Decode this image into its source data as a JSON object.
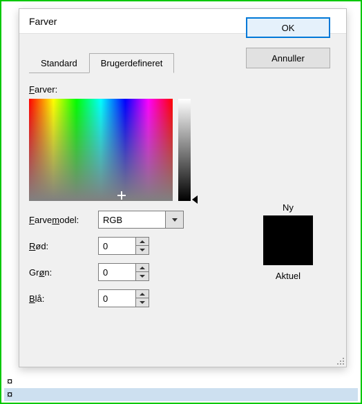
{
  "dialog": {
    "title": "Farver",
    "help": "?",
    "close": "✕"
  },
  "tabs": {
    "standard": "Standard",
    "custom": "Brugerdefineret"
  },
  "buttons": {
    "ok": "OK",
    "cancel": "Annuller"
  },
  "labels": {
    "colors": "Farver:",
    "model": "Farvemodel:",
    "red": "Rød:",
    "green": "Grøn:",
    "blue": "Blå:",
    "new": "Ny",
    "current": "Aktuel"
  },
  "values": {
    "model": "RGB",
    "red": "0",
    "green": "0",
    "blue": "0"
  },
  "preview_color": "#000000",
  "status": {
    "row1": "¤",
    "row2": "¤"
  }
}
